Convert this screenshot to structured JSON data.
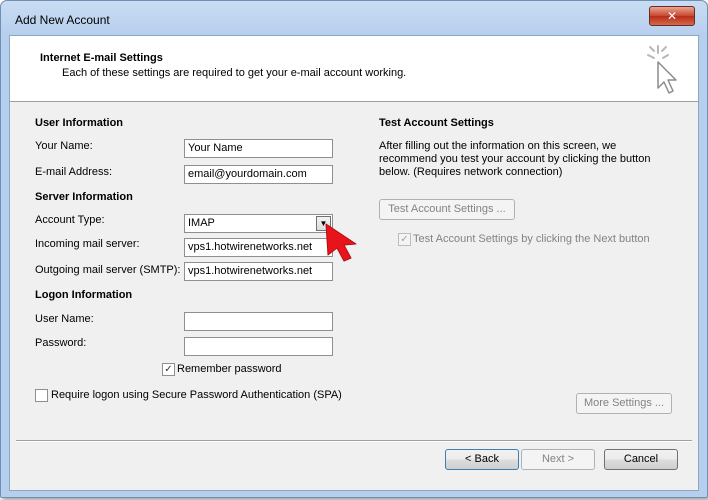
{
  "window": {
    "title": "Add New Account",
    "close_glyph": "✕",
    "close_icon": "close-icon"
  },
  "header": {
    "title": "Internet E-mail Settings",
    "subtitle": "Each of these settings are required to get your e-mail account working.",
    "icon": "cursor-sparkle-icon"
  },
  "user_info": {
    "heading": "User Information",
    "name_label": "Your Name:",
    "name_value": "Your Name",
    "email_label": "E-mail Address:",
    "email_value": "email@yourdomain.com"
  },
  "server_info": {
    "heading": "Server Information",
    "account_type_label": "Account Type:",
    "account_type_value": "IMAP",
    "incoming_label": "Incoming mail server:",
    "incoming_value": "vps1.hotwirenetworks.net",
    "outgoing_label": "Outgoing mail server (SMTP):",
    "outgoing_value": "vps1.hotwirenetworks.net"
  },
  "logon_info": {
    "heading": "Logon Information",
    "username_label": "User Name:",
    "username_value": "",
    "password_label": "Password:",
    "password_value": "",
    "remember_label": "Remember password",
    "remember_checked": true,
    "spa_label": "Require logon using Secure Password Authentication (SPA)",
    "spa_checked": false
  },
  "test_settings": {
    "heading": "Test Account Settings",
    "description": "After filling out the information on this screen, we recommend you test your account by clicking the button below. (Requires network connection)",
    "test_button": "Test Account Settings ...",
    "auto_test_label": "Test Account Settings by clicking the Next button",
    "auto_test_checked": true
  },
  "buttons": {
    "more_settings": "More Settings ...",
    "back": "< Back",
    "next": "Next >",
    "cancel": "Cancel"
  },
  "annotation": {
    "icon": "red-pointer-arrow-icon",
    "color": "#e8141b"
  },
  "check_glyph": "✓"
}
